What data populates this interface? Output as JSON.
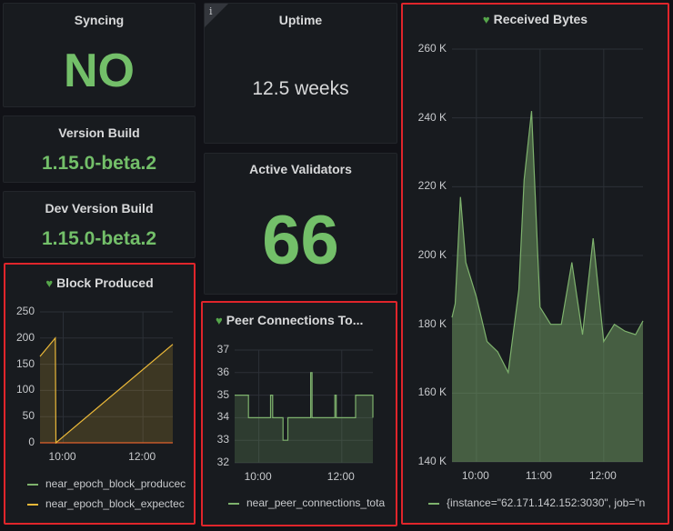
{
  "panels": {
    "syncing": {
      "title": "Syncing",
      "value": "NO"
    },
    "uptime": {
      "title": "Uptime",
      "value": "12.5 weeks",
      "info_icon": "i"
    },
    "version_build": {
      "title": "Version Build",
      "value": "1.15.0-beta.2"
    },
    "dev_version_build": {
      "title": "Dev Version Build",
      "value": "1.15.0-beta.2"
    },
    "active_validators": {
      "title": "Active Validators",
      "value": "66"
    },
    "block_produced": {
      "title": "Block Produced",
      "status_icon": "heart-icon",
      "yticks": [
        "250",
        "200",
        "150",
        "100",
        "50",
        "0"
      ],
      "xticks": [
        "10:00",
        "12:00"
      ],
      "legend": [
        "near_epoch_block_producec",
        "near_epoch_block_expectec"
      ]
    },
    "peer_connections": {
      "title": "Peer Connections To...",
      "status_icon": "heart-icon",
      "yticks": [
        "37",
        "36",
        "35",
        "34",
        "33",
        "32"
      ],
      "xticks": [
        "10:00",
        "12:00"
      ],
      "legend": [
        "near_peer_connections_tota"
      ]
    },
    "received_bytes": {
      "title": "Received Bytes",
      "status_icon": "heart-icon",
      "yticks": [
        "260 K",
        "240 K",
        "220 K",
        "200 K",
        "180 K",
        "160 K",
        "140 K"
      ],
      "xticks": [
        "10:00",
        "11:00",
        "12:00"
      ],
      "legend": [
        "{instance=\"62.171.142.152:3030\", job=\"n"
      ]
    }
  },
  "colors": {
    "value_green": "#73bf69",
    "series_green": "#7eb26d",
    "series_yellow": "#eab839",
    "highlight_red": "#e0252b"
  },
  "chart_data": [
    {
      "type": "line",
      "title": "Block Produced",
      "x_ticks": [
        "10:00",
        "12:00"
      ],
      "ylim": [
        0,
        250
      ],
      "series": [
        {
          "name": "near_epoch_block_producec",
          "x": [
            "09:25",
            "10:00",
            "12:45"
          ],
          "values": [
            0,
            0,
            0
          ]
        },
        {
          "name": "near_epoch_block_expectec",
          "x": [
            "09:25",
            "09:48",
            "09:49",
            "12:45"
          ],
          "values": [
            165,
            200,
            0,
            188
          ]
        }
      ]
    },
    {
      "type": "line",
      "title": "Peer Connections To...",
      "x_ticks": [
        "10:00",
        "12:00"
      ],
      "ylim": [
        32,
        37
      ],
      "series": [
        {
          "name": "near_peer_connections_tota",
          "x": [
            "09:25",
            "09:40",
            "09:45",
            "10:15",
            "10:17",
            "10:20",
            "10:35",
            "10:37",
            "10:42",
            "11:15",
            "11:17",
            "11:50",
            "11:52",
            "12:20",
            "12:45"
          ],
          "values": [
            35,
            35,
            34,
            34,
            35,
            34,
            33,
            33,
            34,
            36,
            34,
            35,
            34,
            35,
            34
          ]
        }
      ]
    },
    {
      "type": "area",
      "title": "Received Bytes",
      "x_ticks": [
        "10:00",
        "11:00",
        "12:00"
      ],
      "ylim": [
        140000,
        260000
      ],
      "series": [
        {
          "name": "{instance=\"62.171.142.152:3030\", job=\"n",
          "x": [
            "09:37",
            "09:40",
            "09:45",
            "09:50",
            "10:00",
            "10:10",
            "10:20",
            "10:30",
            "10:40",
            "10:45",
            "10:52",
            "11:00",
            "11:10",
            "11:20",
            "11:30",
            "11:40",
            "11:50",
            "12:00",
            "12:10",
            "12:20",
            "12:30",
            "12:37"
          ],
          "values": [
            182000,
            186000,
            217000,
            198000,
            188000,
            175000,
            172000,
            166000,
            190000,
            222000,
            242000,
            185000,
            180000,
            180000,
            198000,
            177000,
            205000,
            175000,
            180000,
            178000,
            177000,
            181000
          ]
        }
      ]
    }
  ]
}
